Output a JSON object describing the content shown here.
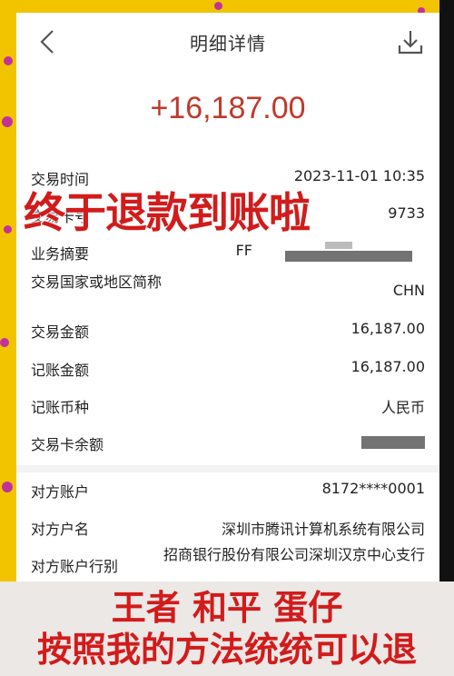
{
  "header": {
    "title": "明细详情",
    "back_icon": "chevron-left-icon",
    "download_icon": "download-icon"
  },
  "amount": "+16,187.00",
  "details": [
    {
      "label": "交易时间",
      "value": "2023-11-01 10:35"
    },
    {
      "label": "交易卡号",
      "value": "9733"
    },
    {
      "label": "业务摘要",
      "value": "FF"
    },
    {
      "label": "交易国家或地区简称",
      "value": "CHN"
    },
    {
      "label": "交易金额",
      "value": "16,187.00"
    },
    {
      "label": "记账金额",
      "value": "16,187.00"
    },
    {
      "label": "记账币种",
      "value": "人民币"
    },
    {
      "label": "交易卡余额",
      "value": ""
    }
  ],
  "counterparty": [
    {
      "label": "对方账户",
      "value": "8172****0001"
    },
    {
      "label": "对方户名",
      "value": "深圳市腾讯计算机系统有限公司"
    },
    {
      "label": "对方账户行别",
      "value": "招商银行股份有限公司深圳汉京中心支行"
    }
  ],
  "overlay": {
    "top_caption": "终于退款到账啦",
    "bottom_line1": "王者 和平 蛋仔",
    "bottom_line2": "按照我的方法统统可以退"
  },
  "colors": {
    "amount": "#c0392b",
    "overlay_text": "#d21b1b",
    "frame": "#f2c400",
    "dots": "#c2329a"
  }
}
